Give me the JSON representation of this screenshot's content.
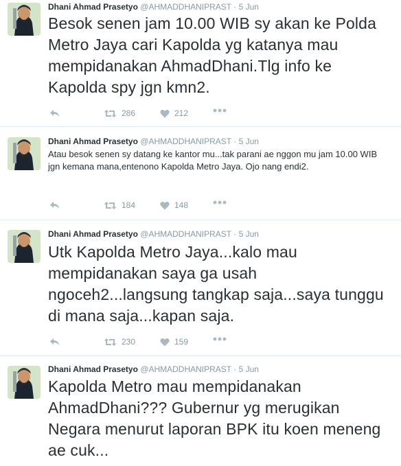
{
  "colors": {
    "text": "#292f33",
    "muted": "#8899a6",
    "icon": "#aab8c2",
    "divider": "#e1e8ed"
  },
  "tweets": [
    {
      "name": "Dhani Ahmad Prasetyo",
      "handle": "@AHMADDHANIPRAST",
      "dot": "·",
      "time": "5 Jun",
      "text": "Besok senen jam 10.00 WIB sy akan ke Polda Metro Jaya cari Kapolda yg katanya mau mempidanakan AhmadDhani.Tlg info ke Kapolda spy jgn kmn2.",
      "retweets": "286",
      "likes": "212"
    },
    {
      "name": "Dhani Ahmad Prasetyo",
      "handle": "@AHMADDHANIPRAST",
      "dot": "·",
      "time": "5 Jun",
      "text": "Atau besok senen sy datang ke kantor mu...tak parani ae nggon mu jam 10.00 WIB jgn kemana mana,entenono Kapolda Metro Jaya. Ojo nang endi2.",
      "retweets": "184",
      "likes": "148"
    },
    {
      "name": "Dhani Ahmad Prasetyo",
      "handle": "@AHMADDHANIPRAST",
      "dot": "·",
      "time": "5 Jun",
      "text": "Utk Kapolda Metro Jaya...kalo mau mempidanakan saya ga usah ngoceh2...langsung tangkap saja...saya tunggu di mana saja...kapan saja.",
      "retweets": "230",
      "likes": "159"
    },
    {
      "name": "Dhani Ahmad Prasetyo",
      "handle": "@AHMADDHANIPRAST",
      "dot": "·",
      "time": "5 Jun",
      "text": "Kapolda Metro mau mempidanakan AhmadDhani??? Gubernur yg merugikan Negara menurut laporan BPK itu koen meneng ae cuk..."
    }
  ]
}
